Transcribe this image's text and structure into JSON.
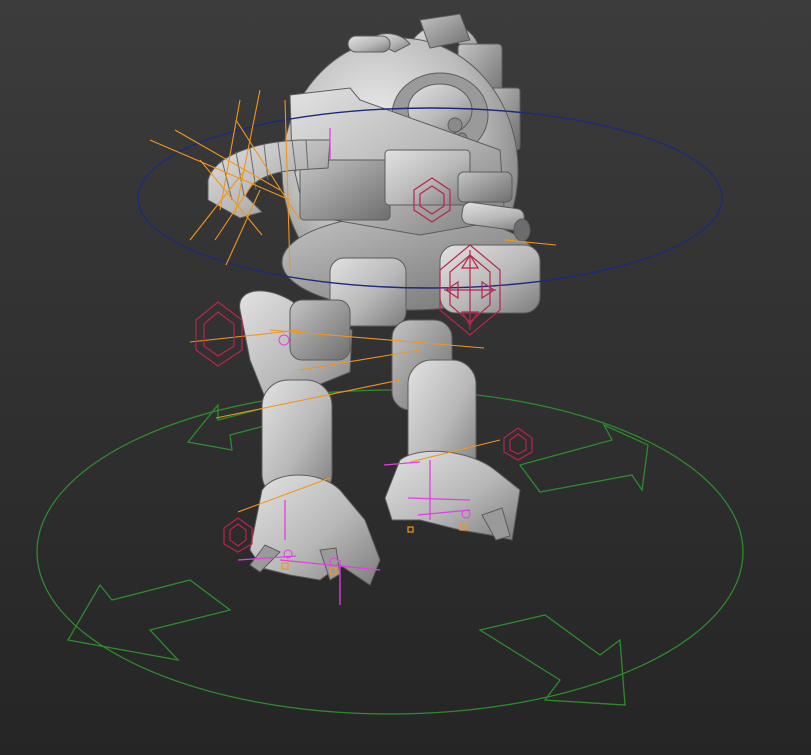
{
  "viewport": {
    "background_top": "#3b3b3b",
    "background_bottom": "#262626",
    "model": "mech-robot",
    "model_color": "#c8c8c8",
    "model_shadow": "#7a7a7a"
  },
  "rig": {
    "root_circle_color": "#2f8a2f",
    "cog_circle_color": "#1c2a7a",
    "bone_color": "#f0961e",
    "ik_handle_color": "#e040e0",
    "gizmo_color": "#b8264c",
    "point_helper_color": "#f0961e"
  }
}
